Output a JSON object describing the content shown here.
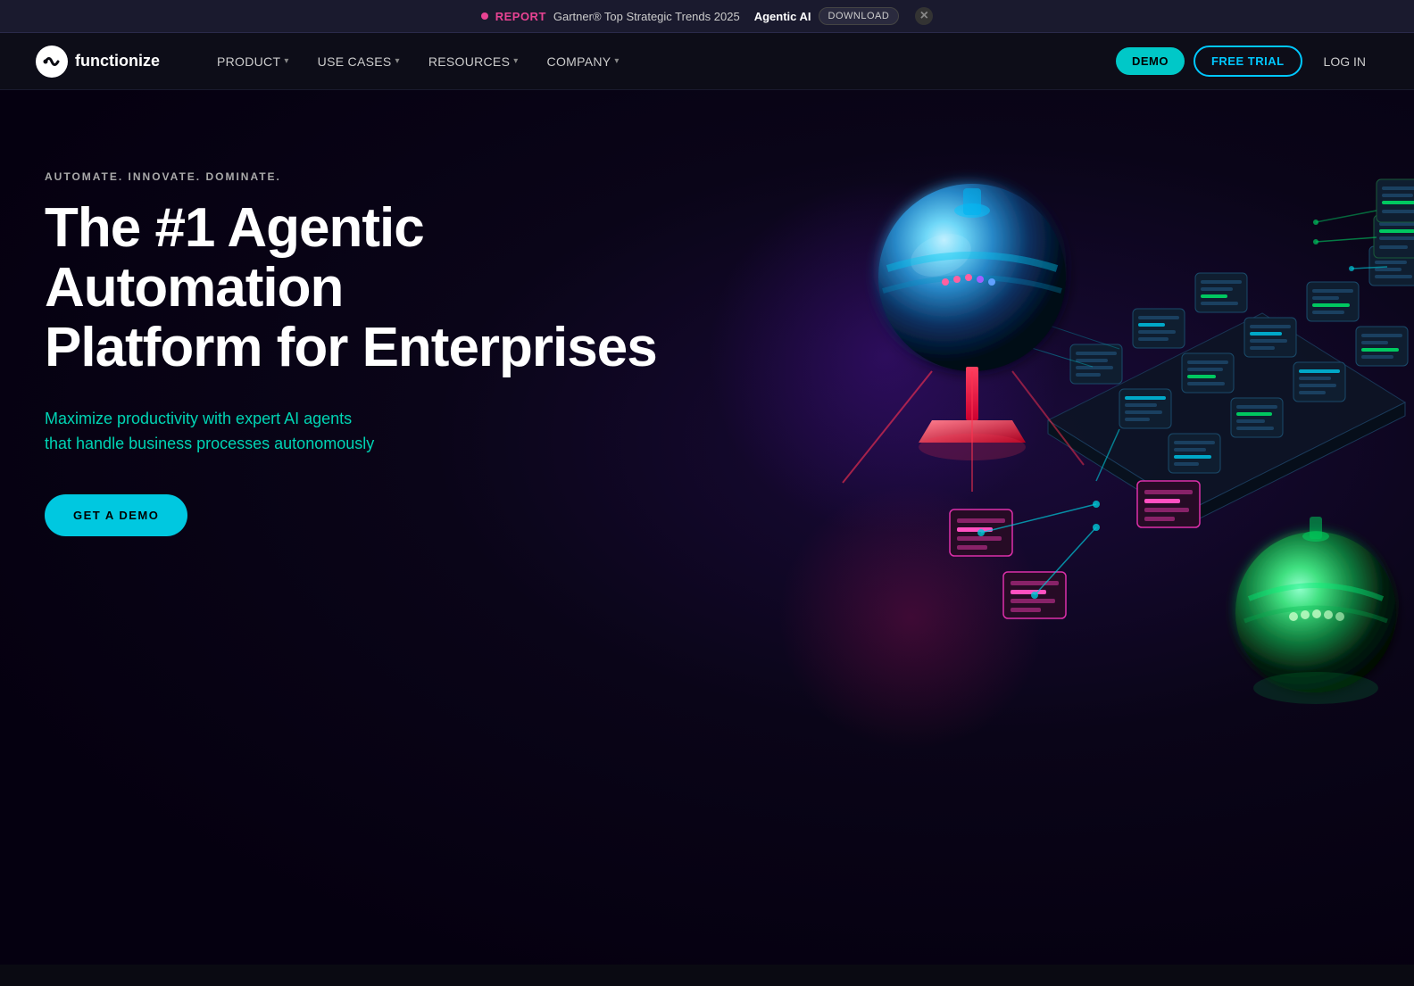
{
  "announcement": {
    "dot_color": "#e84393",
    "report_label": "REPORT",
    "text": "Gartner® Top Strategic Trends 2025",
    "brand": "Agentic AI",
    "download_label": "DOWNLOAD",
    "close_label": "×"
  },
  "navbar": {
    "logo_icon": "ƒ",
    "logo_text": "functionize",
    "nav_items": [
      {
        "label": "PRODUCT",
        "has_dropdown": true
      },
      {
        "label": "USE CASES",
        "has_dropdown": true
      },
      {
        "label": "RESOURCES",
        "has_dropdown": true
      },
      {
        "label": "COMPANY",
        "has_dropdown": true
      }
    ],
    "demo_label": "DEMO",
    "free_trial_label": "FREE TRIAL",
    "login_label": "LOG IN"
  },
  "hero": {
    "eyebrow": "AUTOMATE. INNOVATE. DOMINATE.",
    "title": "The #1 Agentic\nAutomation\nPlatform for Enterprises",
    "subtitle": "Maximize productivity with expert AI agents\nthat handle business processes autonomously",
    "cta_label": "GET A DEMO"
  }
}
